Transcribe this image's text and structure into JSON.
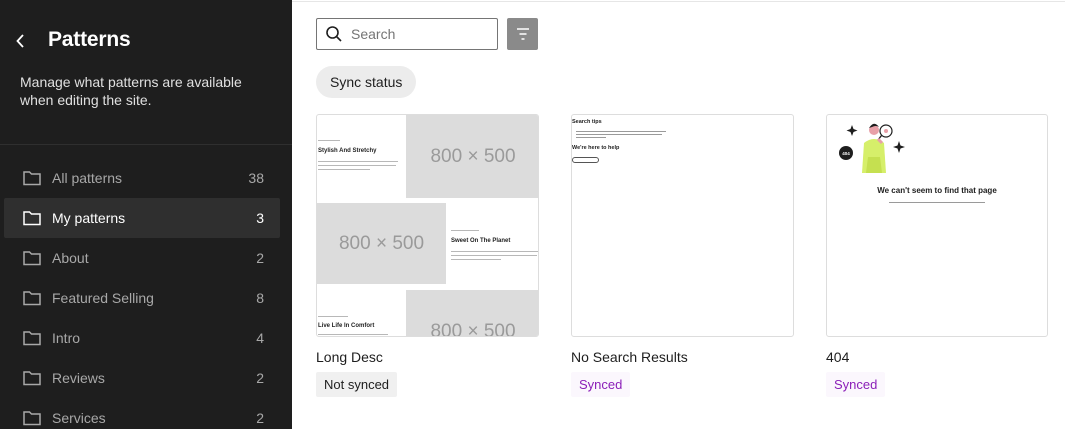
{
  "sidebar": {
    "title": "Patterns",
    "description": "Manage what patterns are available when editing the site.",
    "items": [
      {
        "label": "All patterns",
        "count": "38"
      },
      {
        "label": "My patterns",
        "count": "3"
      },
      {
        "label": "About",
        "count": "2"
      },
      {
        "label": "Featured Selling",
        "count": "8"
      },
      {
        "label": "Intro",
        "count": "4"
      },
      {
        "label": "Reviews",
        "count": "2"
      },
      {
        "label": "Services",
        "count": "2"
      }
    ]
  },
  "toolbar": {
    "search_placeholder": "Search",
    "chip_label": "Sync status"
  },
  "patterns": [
    {
      "title": "Long Desc",
      "status": "Not synced",
      "preview": {
        "placeholder": "800 × 500",
        "head1": "Stylish And Stretchy",
        "head2": "Sweet On The Planet",
        "head3": "Live Life In Comfort"
      }
    },
    {
      "title": "No Search Results",
      "status": "Synced",
      "preview": {
        "head1": "Search tips",
        "head2": "We're here to help"
      }
    },
    {
      "title": "404",
      "status": "Synced",
      "preview": {
        "heading": "We can't seem to find that page"
      }
    }
  ],
  "colors": {
    "sidebar_bg": "#1e1e1e",
    "active_item_bg": "#2f2f2f",
    "synced_purple": "#8b1fb8",
    "placeholder_gray": "#dcdcdc"
  },
  "icons": {
    "back": "chevron-left-icon",
    "folder": "folder-icon",
    "search": "search-icon",
    "filter": "filter-icon"
  }
}
